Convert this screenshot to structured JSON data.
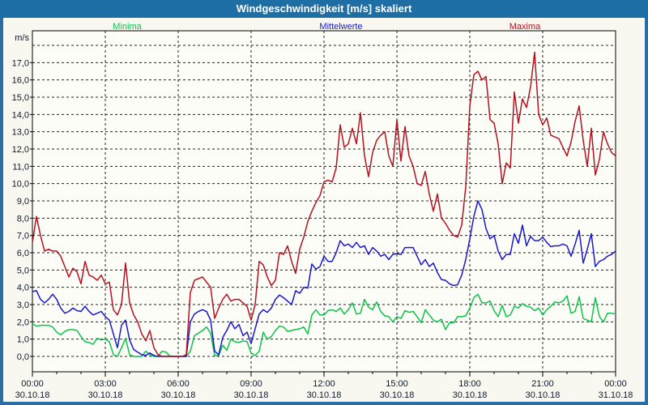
{
  "window": {
    "title": "Windgeschwindigkeit [m/s] skaliert",
    "titlebar_color": "#1d6ea5",
    "frame_color": "#2b6da5"
  },
  "chart_data": {
    "type": "line",
    "title": "Windgeschwindigkeit [m/s] skaliert",
    "grid": "dashed",
    "legend_position": "top",
    "sample_interval_minutes": 10,
    "y_axis": {
      "unit_label": "m/s",
      "min": -0.9,
      "max": 18.85,
      "gridline_step": 1.0,
      "tick_labels": [
        "0,0",
        "1,0",
        "2,0",
        "3,0",
        "4,0",
        "5,0",
        "6,0",
        "7,0",
        "8,0",
        "9,0",
        "10,0",
        "11,0",
        "12,0",
        "13,0",
        "14,0",
        "15,0",
        "16,0",
        "17,0"
      ]
    },
    "x_axis": {
      "hours_span": 24,
      "major_tick_every_hours": 3,
      "minor_tick_every_hours": 1,
      "ticks": [
        {
          "time": "00:00",
          "date": "30.10.18"
        },
        {
          "time": "03:00",
          "date": "30.10.18"
        },
        {
          "time": "06:00",
          "date": "30.10.18"
        },
        {
          "time": "09:00",
          "date": "30.10.18"
        },
        {
          "time": "12:00",
          "date": "30.10.18"
        },
        {
          "time": "15:00",
          "date": "30.10.18"
        },
        {
          "time": "18:00",
          "date": "30.10.18"
        },
        {
          "time": "21:00",
          "date": "30.10.18"
        },
        {
          "time": "00:00",
          "date": "31.10.18"
        }
      ]
    },
    "series": [
      {
        "key": "minima",
        "name": "Minima",
        "color": "#0cc34a",
        "values": [
          1.9,
          1.75,
          1.8,
          1.8,
          1.8,
          1.7,
          1.4,
          1.25,
          1.45,
          1.55,
          1.55,
          1.5,
          1.15,
          0.85,
          0.8,
          0.7,
          1.05,
          0.95,
          1.0,
          0.85,
          0.1,
          0,
          0.5,
          1.05,
          0.1,
          0,
          0,
          0,
          0.3,
          0.1,
          0,
          0,
          0.3,
          0.25,
          0,
          0,
          0,
          0,
          0,
          0.3,
          1.2,
          1.35,
          1.5,
          1.7,
          1.35,
          0.05,
          0.05,
          0.65,
          0.35,
          1.0,
          0.85,
          0.8,
          0.9,
          0.85,
          0.2,
          0.05,
          0.3,
          1.4,
          1.0,
          1.15,
          1.5,
          1.75,
          1.7,
          1.45,
          1.5,
          1.55,
          1.6,
          1.7,
          1.3,
          2.4,
          2.7,
          2.4,
          2.4,
          2.65,
          2.7,
          2.6,
          2.8,
          2.45,
          2.7,
          3.1,
          2.45,
          2.5,
          3.3,
          2.85,
          2.7,
          3.15,
          2.6,
          2.35,
          2.3,
          2.0,
          2.3,
          2.2,
          2.65,
          2.55,
          2.6,
          2.3,
          1.95,
          2.7,
          2.4,
          2.1,
          2.0,
          2.15,
          1.55,
          1.95,
          1.95,
          2.3,
          2.3,
          2.35,
          2.8,
          3.4,
          3.6,
          3.1,
          3.1,
          3.2,
          2.65,
          2.3,
          2.95,
          2.3,
          2.4,
          2.9,
          2.8,
          3.05,
          2.9,
          2.85,
          2.65,
          2.8,
          2.4,
          2.7,
          2.9,
          3.15,
          3.1,
          3.2,
          3.5,
          2.5,
          2.6,
          3.45,
          2.2,
          2.1,
          2.0,
          3.4,
          2.3,
          2.0,
          2.5,
          2.5,
          2.45
        ]
      },
      {
        "key": "mittelwerte",
        "name": "Mittelwerte",
        "color": "#1818cc",
        "values": [
          3.75,
          3.8,
          3.3,
          3.1,
          3.3,
          3.6,
          3.3,
          2.8,
          2.5,
          2.6,
          2.8,
          2.65,
          2.6,
          2.9,
          2.6,
          2.4,
          2.5,
          2.6,
          2.3,
          2.1,
          1.3,
          0.5,
          1.8,
          2.1,
          0.95,
          0.4,
          0.25,
          0.1,
          0.05,
          0.2,
          0.05,
          0,
          0,
          0,
          0,
          0,
          0,
          0,
          0,
          2.0,
          2.45,
          2.6,
          2.7,
          2.6,
          2.1,
          0.3,
          0.1,
          1.1,
          1.5,
          2.0,
          1.6,
          1.85,
          1.2,
          1.4,
          0.75,
          1.6,
          2.45,
          2.7,
          2.55,
          2.8,
          3.3,
          3.55,
          3.4,
          3.2,
          3.0,
          3.8,
          3.65,
          4.0,
          3.95,
          5.35,
          5.05,
          5.2,
          5.8,
          5.5,
          5.5,
          6.0,
          6.7,
          6.4,
          6.5,
          6.3,
          6.6,
          6.3,
          6.4,
          5.9,
          6.3,
          6.1,
          5.8,
          5.9,
          5.6,
          5.9,
          5.95,
          5.9,
          6.3,
          6.3,
          6.3,
          5.8,
          5.3,
          5.6,
          5.2,
          5.4,
          4.85,
          4.45,
          4.4,
          4.2,
          4.1,
          4.15,
          4.7,
          5.6,
          6.8,
          8.1,
          9.0,
          8.5,
          7.4,
          6.8,
          7.0,
          6.1,
          5.6,
          5.9,
          5.9,
          7.1,
          6.55,
          7.6,
          6.4,
          6.95,
          6.7,
          6.7,
          6.9,
          6.6,
          6.35,
          6.4,
          6.4,
          6.5,
          6.4,
          5.8,
          6.5,
          7.3,
          5.4,
          6.2,
          7.1,
          5.2,
          5.5,
          5.6,
          5.8,
          5.9,
          6.1
        ]
      },
      {
        "key": "maxima",
        "name": "Maxima",
        "color": "#b31220",
        "values": [
          6.6,
          8.1,
          7.0,
          6.1,
          6.2,
          6.1,
          6.1,
          5.8,
          5.2,
          4.6,
          5.1,
          4.9,
          4.2,
          5.5,
          4.7,
          4.6,
          4.4,
          4.7,
          4.2,
          4.3,
          2.7,
          2.4,
          3.0,
          5.4,
          3.1,
          2.4,
          2.0,
          1.3,
          0.9,
          1.5,
          0.5,
          0.1,
          0,
          0,
          0,
          0,
          0,
          0,
          0.1,
          3.7,
          4.4,
          4.5,
          4.6,
          4.3,
          4.0,
          2.2,
          2.8,
          3.3,
          3.6,
          3.2,
          3.3,
          3.3,
          3.1,
          2.9,
          2.1,
          3.0,
          5.5,
          5.3,
          4.6,
          4.1,
          4.4,
          6.0,
          5.9,
          6.4,
          5.5,
          4.8,
          6.2,
          6.9,
          7.8,
          8.4,
          8.9,
          9.3,
          10.1,
          10.2,
          10.1,
          10.9,
          13.4,
          12.1,
          12.3,
          13.2,
          12.3,
          14.1,
          11.6,
          10.4,
          11.8,
          12.5,
          12.8,
          13.0,
          11.6,
          11.0,
          13.7,
          11.3,
          13.3,
          11.6,
          11.0,
          10.0,
          9.9,
          10.7,
          9.4,
          8.4,
          9.4,
          8.0,
          7.7,
          7.3,
          7.0,
          6.9,
          7.6,
          9.8,
          14.5,
          16.3,
          16.5,
          16.0,
          16.2,
          13.7,
          13.5,
          12.3,
          10.0,
          11.2,
          10.9,
          15.3,
          13.5,
          14.9,
          14.4,
          15.6,
          17.6,
          14.0,
          13.4,
          13.8,
          12.8,
          12.7,
          12.6,
          12.1,
          11.6,
          12.4,
          13.6,
          14.5,
          12.5,
          11.0,
          13.2,
          10.5,
          11.4,
          13.0,
          12.3,
          11.8,
          11.6
        ]
      }
    ]
  }
}
